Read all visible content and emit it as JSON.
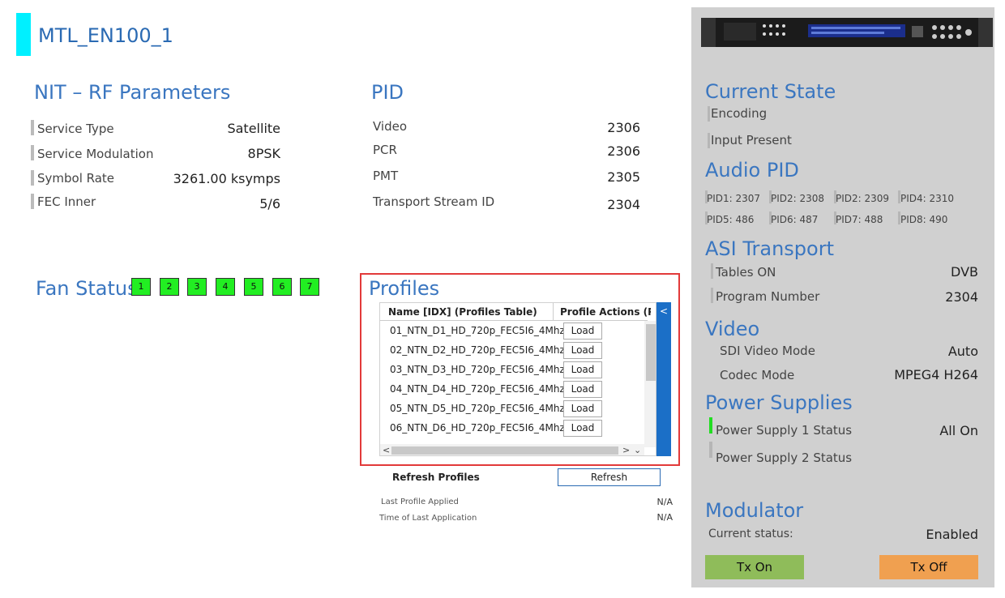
{
  "device_title": "MTL_EN100_1",
  "nit": {
    "heading": "NIT – RF Parameters",
    "rows": [
      {
        "label": "Service Type",
        "value": "Satellite"
      },
      {
        "label": "Service Modulation",
        "value": "8PSK"
      },
      {
        "label": "Symbol Rate",
        "value": "3261.00 ksymps"
      },
      {
        "label": "FEC Inner",
        "value": "5/6"
      }
    ]
  },
  "pid": {
    "heading": "PID",
    "rows": [
      {
        "label": "Video",
        "value": "2306"
      },
      {
        "label": "PCR",
        "value": "2306"
      },
      {
        "label": "PMT",
        "value": "2305"
      },
      {
        "label": "Transport Stream ID",
        "value": "2304"
      }
    ]
  },
  "fan": {
    "heading": "Fan Status",
    "boxes": [
      "1",
      "2",
      "3",
      "4",
      "5",
      "6",
      "7"
    ],
    "color": "#22ee22"
  },
  "profiles": {
    "heading": "Profiles",
    "col_name": "Name [IDX] (Profiles Table)",
    "col_actions": "Profile Actions (P...",
    "load_label": "Load",
    "collapse_glyph": "<",
    "rows": [
      "01_NTN_D1_HD_720p_FEC5I6_4Mhz",
      "02_NTN_D2_HD_720p_FEC5I6_4Mhz",
      "03_NTN_D3_HD_720p_FEC5I6_4Mhz",
      "04_NTN_D4_HD_720p_FEC5I6_4Mhz",
      "05_NTN_D5_HD_720p_FEC5I6_4Mhz",
      "06_NTN_D6_HD_720p_FEC5I6_4Mhz"
    ],
    "refresh_label": "Refresh Profiles",
    "refresh_button": "Refresh",
    "last_applied_label": "Last Profile Applied",
    "last_applied_value": "N/A",
    "time_label": "Time of Last Application",
    "time_value": "N/A"
  },
  "right": {
    "current_state": {
      "heading": "Current State",
      "items": [
        "Encoding",
        "Input Present"
      ]
    },
    "audio_pid": {
      "heading": "Audio PID",
      "cells": [
        "PID1: 2307",
        "PID2: 2308",
        "PID2: 2309",
        "PID4: 2310",
        "PID5: 486",
        "PID6: 487",
        "PID7: 488",
        "PID8: 490"
      ]
    },
    "asi": {
      "heading": "ASI Transport",
      "rows": [
        {
          "label": "Tables ON",
          "value": "DVB"
        },
        {
          "label": "Program Number",
          "value": "2304"
        }
      ]
    },
    "video": {
      "heading": "Video",
      "rows": [
        {
          "label": "SDI Video Mode",
          "value": "Auto"
        },
        {
          "label": "Codec Mode",
          "value": "MPEG4 H264"
        }
      ]
    },
    "power": {
      "heading": "Power Supplies",
      "rows": [
        {
          "label": "Power Supply 1 Status",
          "value": "All On"
        },
        {
          "label": "Power Supply 2 Status",
          "value": ""
        }
      ],
      "ok_color": "#22dd22"
    },
    "modulator": {
      "heading": "Modulator",
      "status_label": "Current status:",
      "status_value": "Enabled",
      "tx_on": "Tx On",
      "tx_off": "Tx Off"
    }
  },
  "colors": {
    "accent": "#3a76c0",
    "title_bar": "#00f0ff",
    "panel_bg": "#d0d0d0",
    "highlight_border": "#e23a3a",
    "tx_on": "#8fbc5a",
    "tx_off": "#f0a050"
  }
}
